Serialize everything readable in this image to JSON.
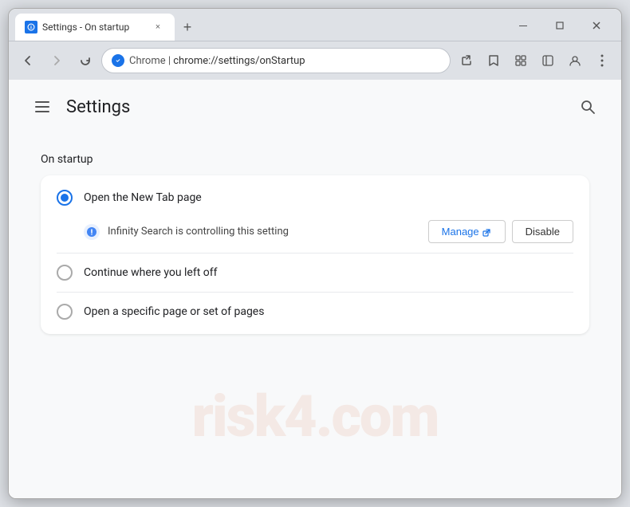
{
  "window": {
    "title": "Settings - On startup",
    "controls": {
      "minimize": "—",
      "maximize": "□",
      "close": "✕"
    }
  },
  "tab": {
    "favicon_text": "⚙",
    "title": "Settings - On startup",
    "close": "×"
  },
  "new_tab_btn": "+",
  "toolbar": {
    "back_btn": "←",
    "forward_btn": "→",
    "refresh_btn": "↻",
    "address_scheme": "Chrome",
    "address_separator": " | ",
    "address_url": "chrome://settings/onStartup",
    "share_icon": "⬆",
    "star_icon": "☆",
    "extension_icon": "🧩",
    "sidebar_icon": "⬜",
    "profile_icon": "👤",
    "menu_icon": "⋮"
  },
  "settings": {
    "menu_btn_label": "Menu",
    "title": "Settings",
    "search_tooltip": "Search settings",
    "section_title": "On startup",
    "options": [
      {
        "id": "new-tab",
        "label": "Open the New Tab page",
        "selected": true
      },
      {
        "id": "continue",
        "label": "Continue where you left off",
        "selected": false
      },
      {
        "id": "specific-page",
        "label": "Open a specific page or set of pages",
        "selected": false
      }
    ],
    "warning": {
      "text": "Infinity Search is controlling this setting",
      "manage_btn": "Manage",
      "disable_btn": "Disable"
    }
  },
  "watermark": "risk4.com"
}
